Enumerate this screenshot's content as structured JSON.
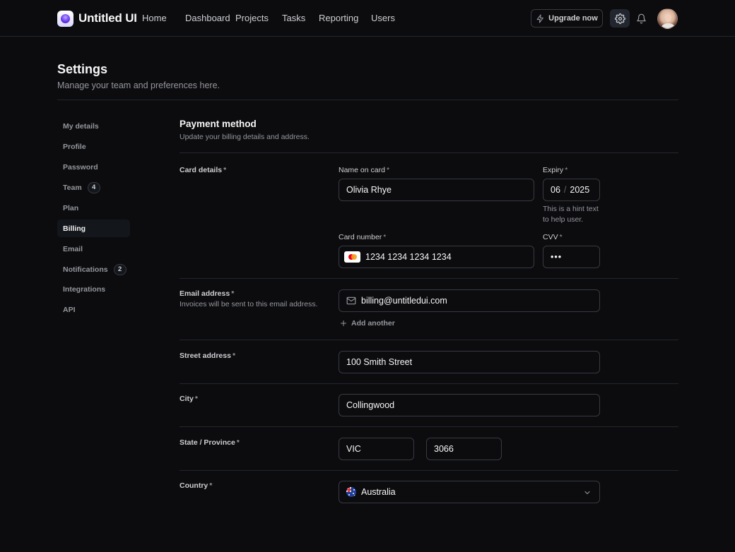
{
  "app": {
    "name": "Untitled UI"
  },
  "nav": {
    "items": [
      "Home",
      "Dashboard",
      "Projects",
      "Tasks",
      "Reporting",
      "Users"
    ],
    "upgrade_label": "Upgrade now"
  },
  "header": {
    "title": "Settings",
    "subtitle": "Manage your team and preferences here."
  },
  "sidebar": {
    "items": [
      {
        "label": "My details"
      },
      {
        "label": "Profile"
      },
      {
        "label": "Password"
      },
      {
        "label": "Team",
        "badge": "4"
      },
      {
        "label": "Plan"
      },
      {
        "label": "Billing",
        "active": true
      },
      {
        "label": "Email"
      },
      {
        "label": "Notifications",
        "badge": "2"
      },
      {
        "label": "Integrations"
      },
      {
        "label": "API"
      }
    ]
  },
  "payment": {
    "title": "Payment method",
    "subtitle": "Update your billing details and address.",
    "required_mark": "*",
    "card_details_label": "Card details",
    "name_on_card_label": "Name on card",
    "name_on_card_value": "Olivia Rhye",
    "expiry_label": "Expiry",
    "expiry_month": "06",
    "expiry_sep": "/",
    "expiry_year": "2025",
    "expiry_hint": "This is a hint text to help user.",
    "card_number_label": "Card number",
    "card_number_value": "1234 1234 1234 1234",
    "cvv_label": "CVV",
    "cvv_value": "•••",
    "email_label": "Email address",
    "email_hint": "Invoices will be sent to this email address.",
    "email_value": "billing@untitledui.com",
    "add_another_label": "Add another",
    "street_label": "Street address",
    "street_value": "100 Smith Street",
    "city_label": "City",
    "city_value": "Collingwood",
    "state_label": "State / Province",
    "state_value": "VIC",
    "postcode_value": "3066",
    "country_label": "Country",
    "country_value": "Australia"
  }
}
